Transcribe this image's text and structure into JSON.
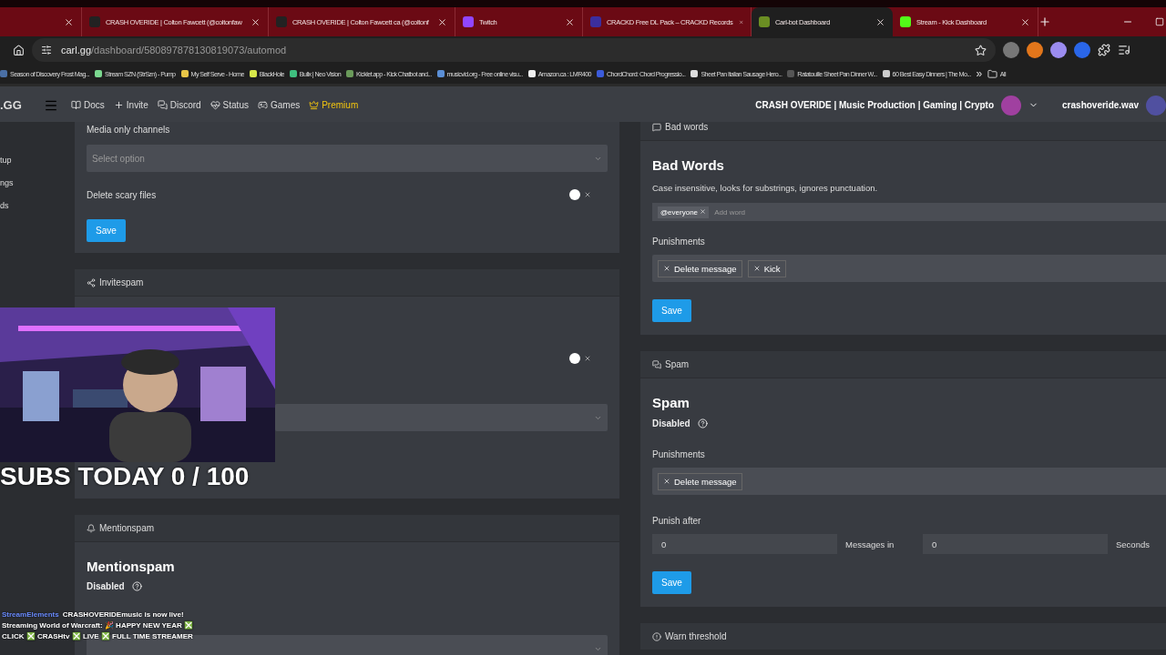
{
  "browser": {
    "tabs": [
      {
        "selected": false
      },
      {
        "title": "CRASH OVERIDE | Colton Fawcett (@coltonfaw",
        "selected": false
      },
      {
        "title": "CRASH OVERIDE | Colton Fawcett ca (@coltonf",
        "selected": false
      },
      {
        "title": "Twitch",
        "selected": false
      },
      {
        "title": "CRACKD Free DL Pack – CRACKD Records",
        "selected": false
      },
      {
        "title": "Carl-bot Dashboard",
        "selected": true
      },
      {
        "title": "Stream - Kick Dashboard",
        "selected": false
      }
    ],
    "url_host": "carl.gg",
    "url_path": "/dashboard/580897878130819073/automod",
    "bookmarks": [
      {
        "title": "Season of Discovery Frost Mag...",
        "color": "#4a6fa5"
      },
      {
        "title": "Stream SZN (StrSzn) - Pump",
        "color": "#7bd88f"
      },
      {
        "title": "My Self Serve - Home",
        "color": "#e8c547"
      },
      {
        "title": "BlackHole",
        "color": "#d8e84a"
      },
      {
        "title": "Bullx | Neo Vision",
        "color": "#3fbf7f"
      },
      {
        "title": "Kicklet.app - Kick Chatbot and...",
        "color": "#6a9a5a"
      },
      {
        "title": "musicvid.org - Free online visu...",
        "color": "#5b8fd6"
      },
      {
        "title": "Amazon.ca : LMR400",
        "color": "#f0f0f0"
      },
      {
        "title": "ChordChord: Chord Progressio...",
        "color": "#3b5bdb"
      },
      {
        "title": "Sheet Pan Italian Sausage Hero...",
        "color": "#dddddd"
      },
      {
        "title": "Ratatouille Sheet Pan Dinner W...",
        "color": "#555555"
      },
      {
        "title": "60 Best Easy Dinners | The Mo...",
        "color": "#cccccc"
      }
    ],
    "bookmarks_more": "»",
    "all_bookmarks": "All"
  },
  "navbar": {
    "logo": ".GG",
    "links": [
      {
        "label": "Docs",
        "kind": "docs"
      },
      {
        "label": "Invite",
        "kind": "invite"
      },
      {
        "label": "Discord",
        "kind": "discord"
      },
      {
        "label": "Status",
        "kind": "status"
      },
      {
        "label": "Games",
        "kind": "games"
      },
      {
        "label": "Premium",
        "kind": "premium"
      }
    ],
    "server": "CRASH OVERIDE | Music Production | Gaming | Crypto",
    "user": "crashoveride.wav"
  },
  "sidebar": {
    "items": [
      "tup",
      "ngs",
      "ds"
    ]
  },
  "left": {
    "media": {
      "label": "Media only channels",
      "placeholder": "Select option",
      "toggle_label": "Delete scary files",
      "on": false,
      "save": "Save"
    },
    "invitespam": {
      "header": "Invitespam",
      "on": false
    },
    "mentionspam": {
      "header": "Mentionspam",
      "title": "Mentionspam",
      "status": "Disabled"
    }
  },
  "right": {
    "badwords": {
      "header": "Bad words",
      "title": "Bad Words",
      "description": "Case insensitive, looks for substrings, ignores punctuation.",
      "words": [
        "@everyone"
      ],
      "word_placeholder": "Add word",
      "punish_label": "Punishments",
      "punishments": [
        "Delete message",
        "Kick"
      ],
      "save": "Save"
    },
    "spam": {
      "header": "Spam",
      "title": "Spam",
      "status": "Disabled",
      "punish_label": "Punishments",
      "punishments": [
        "Delete message"
      ],
      "after_label": "Punish after",
      "messages": "0",
      "messages_unit": "Messages in",
      "seconds": "0",
      "seconds_unit": "Seconds",
      "save": "Save"
    },
    "warn": {
      "header": "Warn threshold"
    }
  },
  "overlay": {
    "subs": "SUBS TODAY 0 / 100",
    "chat_user": "StreamElements",
    "chat_message": "CRASHOVERIDEmusic is now live! Streaming World of Warcraft: 🎉 HAPPY NEW YEAR ❎ CLICK ❎ CRASHtv ❎ LIVE ❎ FULL TIME STREAMER"
  }
}
